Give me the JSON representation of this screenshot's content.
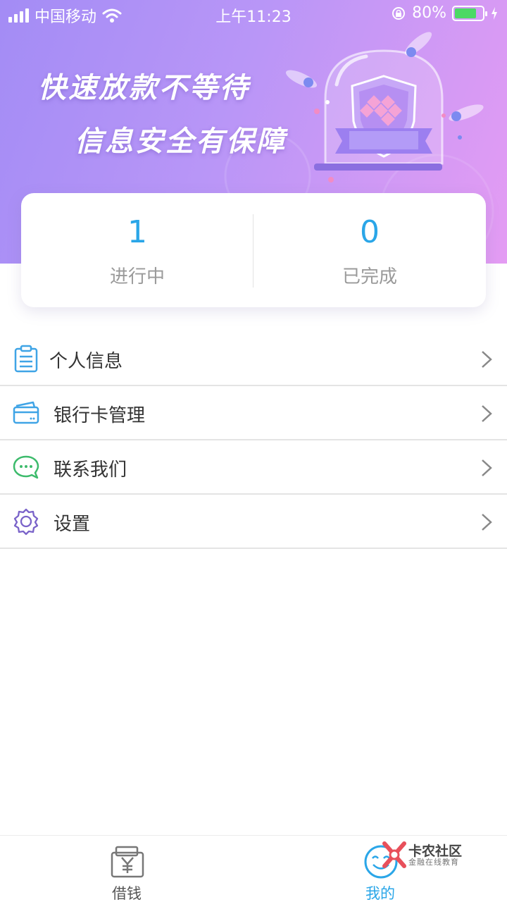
{
  "status_bar": {
    "carrier": "中国移动",
    "time": "上午11:23",
    "battery_percent": "80%",
    "battery_level": 0.8
  },
  "banner": {
    "line1": "快速放款不等待",
    "line2": "信息安全有保障"
  },
  "stats": {
    "in_progress": {
      "value": "1",
      "label": "进行中"
    },
    "completed": {
      "value": "0",
      "label": "已完成"
    }
  },
  "menu": {
    "items": [
      {
        "label": "个人信息",
        "icon": "clipboard-icon"
      },
      {
        "label": "银行卡管理",
        "icon": "bank-card-icon"
      },
      {
        "label": "联系我们",
        "icon": "chat-bubble-icon"
      },
      {
        "label": "设置",
        "icon": "gear-icon"
      }
    ]
  },
  "tabbar": {
    "borrow_label": "借钱",
    "mine_label": "我的",
    "active": "我的"
  },
  "watermark": {
    "title": "卡农社区",
    "subtitle": "金融在线教育"
  },
  "colors": {
    "accent": "#2aa6e8",
    "banner_start": "#a38cf5",
    "banner_end": "#e49cf3"
  }
}
